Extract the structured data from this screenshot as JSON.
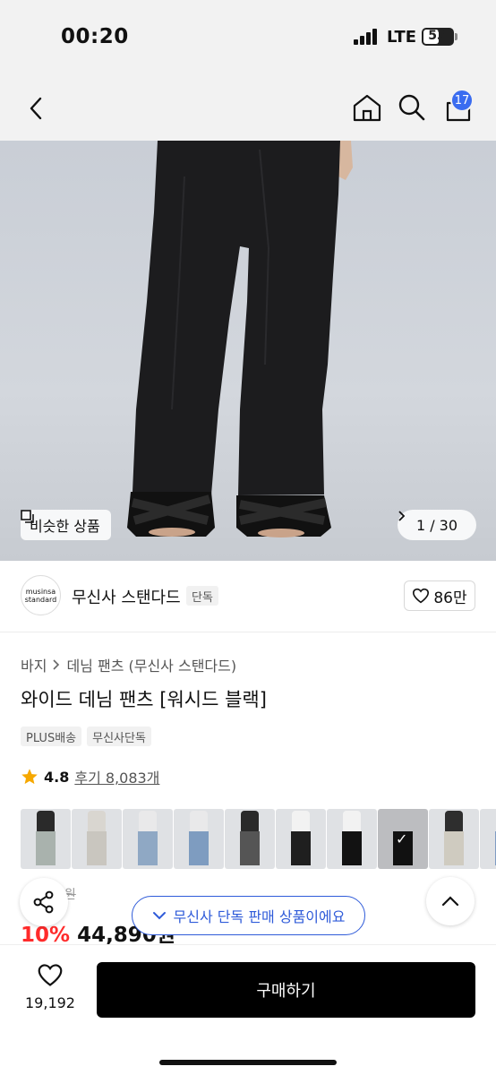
{
  "status": {
    "time": "00:20",
    "network": "LTE",
    "battery": "53",
    "battery_level": 0.53
  },
  "nav": {
    "cart_count": "17",
    "icons": [
      "back-icon",
      "home-icon",
      "search-icon",
      "cart-icon"
    ]
  },
  "gallery": {
    "similar_label": "비슷한 상품",
    "page_indicator": "1 / 30"
  },
  "brand": {
    "logo_line1": "musinsa",
    "logo_line2": "standard",
    "name": "무신사 스탠다드",
    "badge": "단독",
    "likes": "86만"
  },
  "product": {
    "breadcrumb": [
      "바지",
      "데님 팬츠 (무신사 스탠다드)"
    ],
    "title": "와이드 데님 팬츠 [워시드 블랙]",
    "tags": [
      "PLUS배송",
      "무신사단독"
    ],
    "rating": "4.8",
    "reviews": "후기 8,083개",
    "original_price": "9원",
    "discount": "10%",
    "sale_price": "44,890원"
  },
  "thumbnails": [
    {
      "top": "#2a2a2a",
      "pants": "#a9b2ad",
      "active": false
    },
    {
      "top": "#d9d6d0",
      "pants": "#c9c6bf",
      "active": false
    },
    {
      "top": "#e9e9ea",
      "pants": "#8fa8c4",
      "active": false
    },
    {
      "top": "#e9e9ea",
      "pants": "#7e9cc0",
      "active": false
    },
    {
      "top": "#2a2a2a",
      "pants": "#555555",
      "active": false
    },
    {
      "top": "#f2f2f2",
      "pants": "#1f1f1f",
      "active": false
    },
    {
      "top": "#f2f2f2",
      "pants": "#121212",
      "active": false
    },
    {
      "top": "#bcbdc0",
      "pants": "#111111",
      "active": true
    },
    {
      "top": "#2e2e2e",
      "pants": "#cfcbc0",
      "active": false
    },
    {
      "top": "#efefef",
      "pants": "#7f9cc3",
      "active": false
    },
    {
      "top": "#e5e5e5",
      "pants": "#2a2a2a",
      "active": false
    }
  ],
  "notice": {
    "text": "무신사 단독 판매 상품이에요"
  },
  "bottom": {
    "wish_count": "19,192",
    "buy_label": "구매하기"
  },
  "colors": {
    "accent_blue": "#2f5bd9",
    "sale_red": "#ff2b2b",
    "badge_blue": "#3a6cf0"
  }
}
